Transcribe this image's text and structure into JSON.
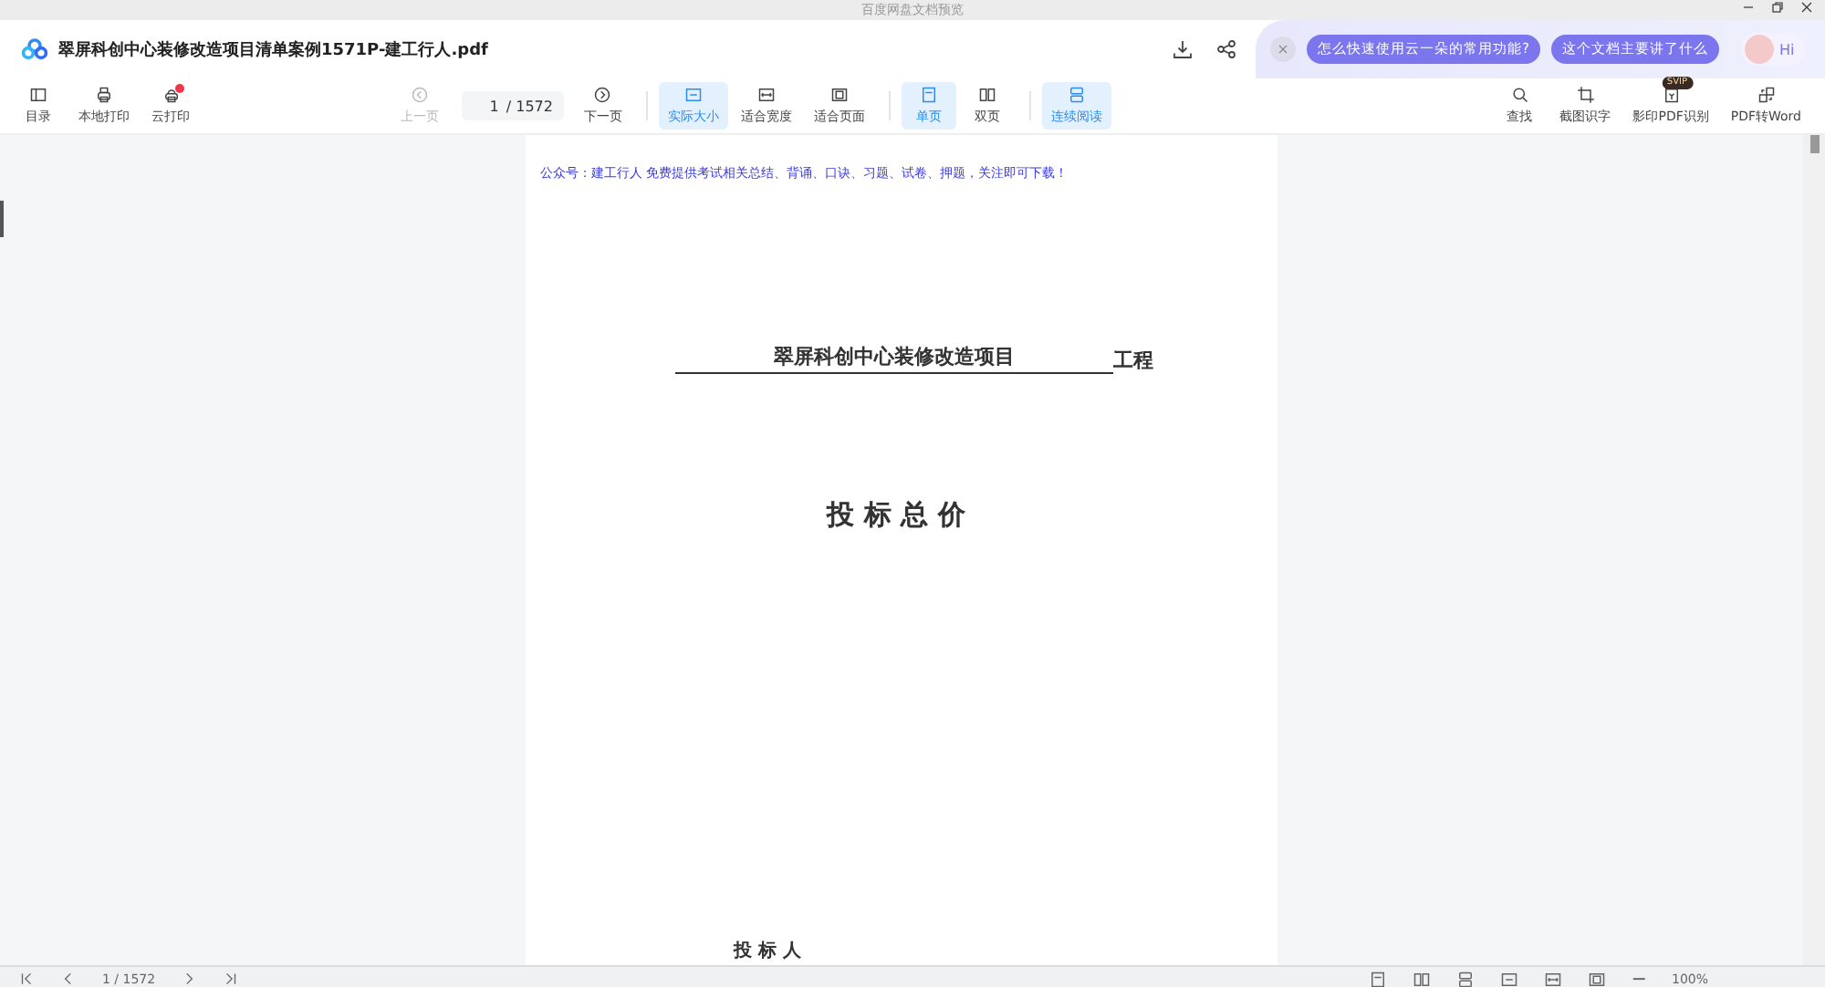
{
  "window": {
    "title": "百度网盘文档预览"
  },
  "header": {
    "file_name": "翠屏科创中心装修改造项目清单案例1571P-建工行人.pdf"
  },
  "assistant": {
    "suggestions": [
      "怎么快速使用云一朵的常用功能?",
      "这个文档主要讲了什么"
    ],
    "greeting": "Hi"
  },
  "toolbar": {
    "left": [
      {
        "label": "目录",
        "badge": false
      },
      {
        "label": "本地打印",
        "badge": false
      },
      {
        "label": "云打印",
        "badge": true
      }
    ],
    "prev": {
      "label": "上一页",
      "disabled": true
    },
    "page": {
      "value": "1",
      "total": "/ 1572"
    },
    "next": {
      "label": "下一页",
      "disabled": false
    },
    "groups": [
      [
        {
          "label": "实际大小",
          "selected": true
        },
        {
          "label": "适合宽度",
          "selected": false
        },
        {
          "label": "适合页面",
          "selected": false
        }
      ],
      [
        {
          "label": "单页",
          "selected": true
        },
        {
          "label": "双页",
          "selected": false
        }
      ],
      [
        {
          "label": "连续阅读",
          "selected": true
        }
      ]
    ],
    "right": [
      {
        "label": "查找"
      },
      {
        "label": "截图识字"
      },
      {
        "label": "影印PDF识别",
        "tag": "SVIP"
      },
      {
        "label": "PDF转Word"
      }
    ]
  },
  "document": {
    "notice": "公众号：建工行人 免费提供考试相关总结、背诵、口诀、习题、试卷、押题，关注即可下载！",
    "project_name": "翠屏科创中心装修改造项目",
    "project_suffix": "工程",
    "heading": "投 标 总 价",
    "cut_label": "投 标 人"
  },
  "footer": {
    "page": "1 / 1572",
    "zoom": "100%",
    "zoom_out": "−"
  }
}
